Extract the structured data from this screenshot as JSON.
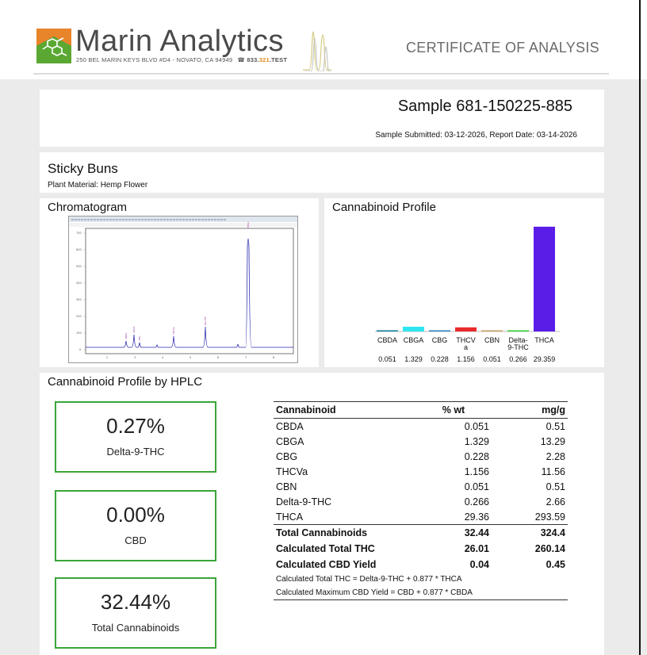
{
  "header": {
    "brand": "Marin Analytics",
    "address": "250 BEL MARIN KEYS BLVD #D4 - NOVATO, CA 94949",
    "phone_prefix": "833.",
    "phone_mid": "321",
    "phone_suffix": ".TEST",
    "doc_title": "CERTIFICATE OF ANALYSIS",
    "logo_icon": "molecule-logo-icon",
    "colors": {
      "logo_orange": "#e8842a",
      "logo_green": "#5aa832",
      "brand_text": "#4a4a4a",
      "accent_green": "#3aa53a"
    }
  },
  "sample": {
    "title": "Sample 681-150225-885",
    "dates": "Sample Submitted: 03-12-2026, Report Date: 03-14-2026"
  },
  "product": {
    "name": "Sticky Buns",
    "material": "Plant Material: Hemp Flower"
  },
  "chromatogram": {
    "title": "Chromatogram"
  },
  "profile": {
    "title": "Cannabinoid Profile"
  },
  "chart_data": {
    "type": "bar",
    "categories": [
      "CBDA",
      "CBGA",
      "CBG",
      "THCVa",
      "CBN",
      "Delta-9-THC",
      "THCA"
    ],
    "category_labels": [
      [
        "CBDA"
      ],
      [
        "CBGA"
      ],
      [
        "CBG"
      ],
      [
        "THCV",
        "a"
      ],
      [
        "CBN"
      ],
      [
        "Delta-",
        "9-THC"
      ],
      [
        "THCA"
      ]
    ],
    "values": [
      0.051,
      1.329,
      0.228,
      1.156,
      0.051,
      0.266,
      29.359
    ],
    "value_labels": [
      "0.051",
      "1.329",
      "0.228",
      "1.156",
      "0.051",
      "0.266",
      "29.359"
    ],
    "colors": [
      "#0e7fa0",
      "#2fe6f0",
      "#2b86c8",
      "#e82b2b",
      "#c8a060",
      "#2bd62b",
      "#5a1de8"
    ],
    "title": "",
    "ylim": [
      0,
      30
    ],
    "grid": false,
    "legend": "none"
  },
  "hplc": {
    "title": "Cannabinoid Profile by HPLC",
    "summary": [
      {
        "value": "0.27%",
        "label": "Delta-9-THC"
      },
      {
        "value": "0.00%",
        "label": "CBD"
      },
      {
        "value": "32.44%",
        "label": "Total Cannabinoids"
      }
    ],
    "headers": [
      "Cannabinoid",
      "% wt",
      "mg/g"
    ],
    "rows": [
      {
        "name": "CBDA",
        "wt": "0.051",
        "mg": "0.51"
      },
      {
        "name": "CBGA",
        "wt": "1.329",
        "mg": "13.29"
      },
      {
        "name": "CBG",
        "wt": "0.228",
        "mg": "2.28"
      },
      {
        "name": "THCVa",
        "wt": "1.156",
        "mg": "11.56"
      },
      {
        "name": "CBN",
        "wt": "0.051",
        "mg": "0.51"
      },
      {
        "name": "Delta-9-THC",
        "wt": "0.266",
        "mg": "2.66"
      },
      {
        "name": "THCA",
        "wt": "29.36",
        "mg": "293.59"
      }
    ],
    "total": {
      "name": "Total Cannabinoids",
      "wt": "32.44",
      "mg": "324.4"
    },
    "thc": {
      "name": "Calculated Total THC",
      "wt": "26.01",
      "mg": "260.14"
    },
    "cbd": {
      "name": "Calculated CBD Yield",
      "wt": "0.04",
      "mg": "0.45"
    },
    "note1": "Calculated Total THC = Delta-9-THC + 0.877 * THCA",
    "note2": "Calculated Maximum CBD Yield = CBD + 0.877 * CBDA"
  }
}
